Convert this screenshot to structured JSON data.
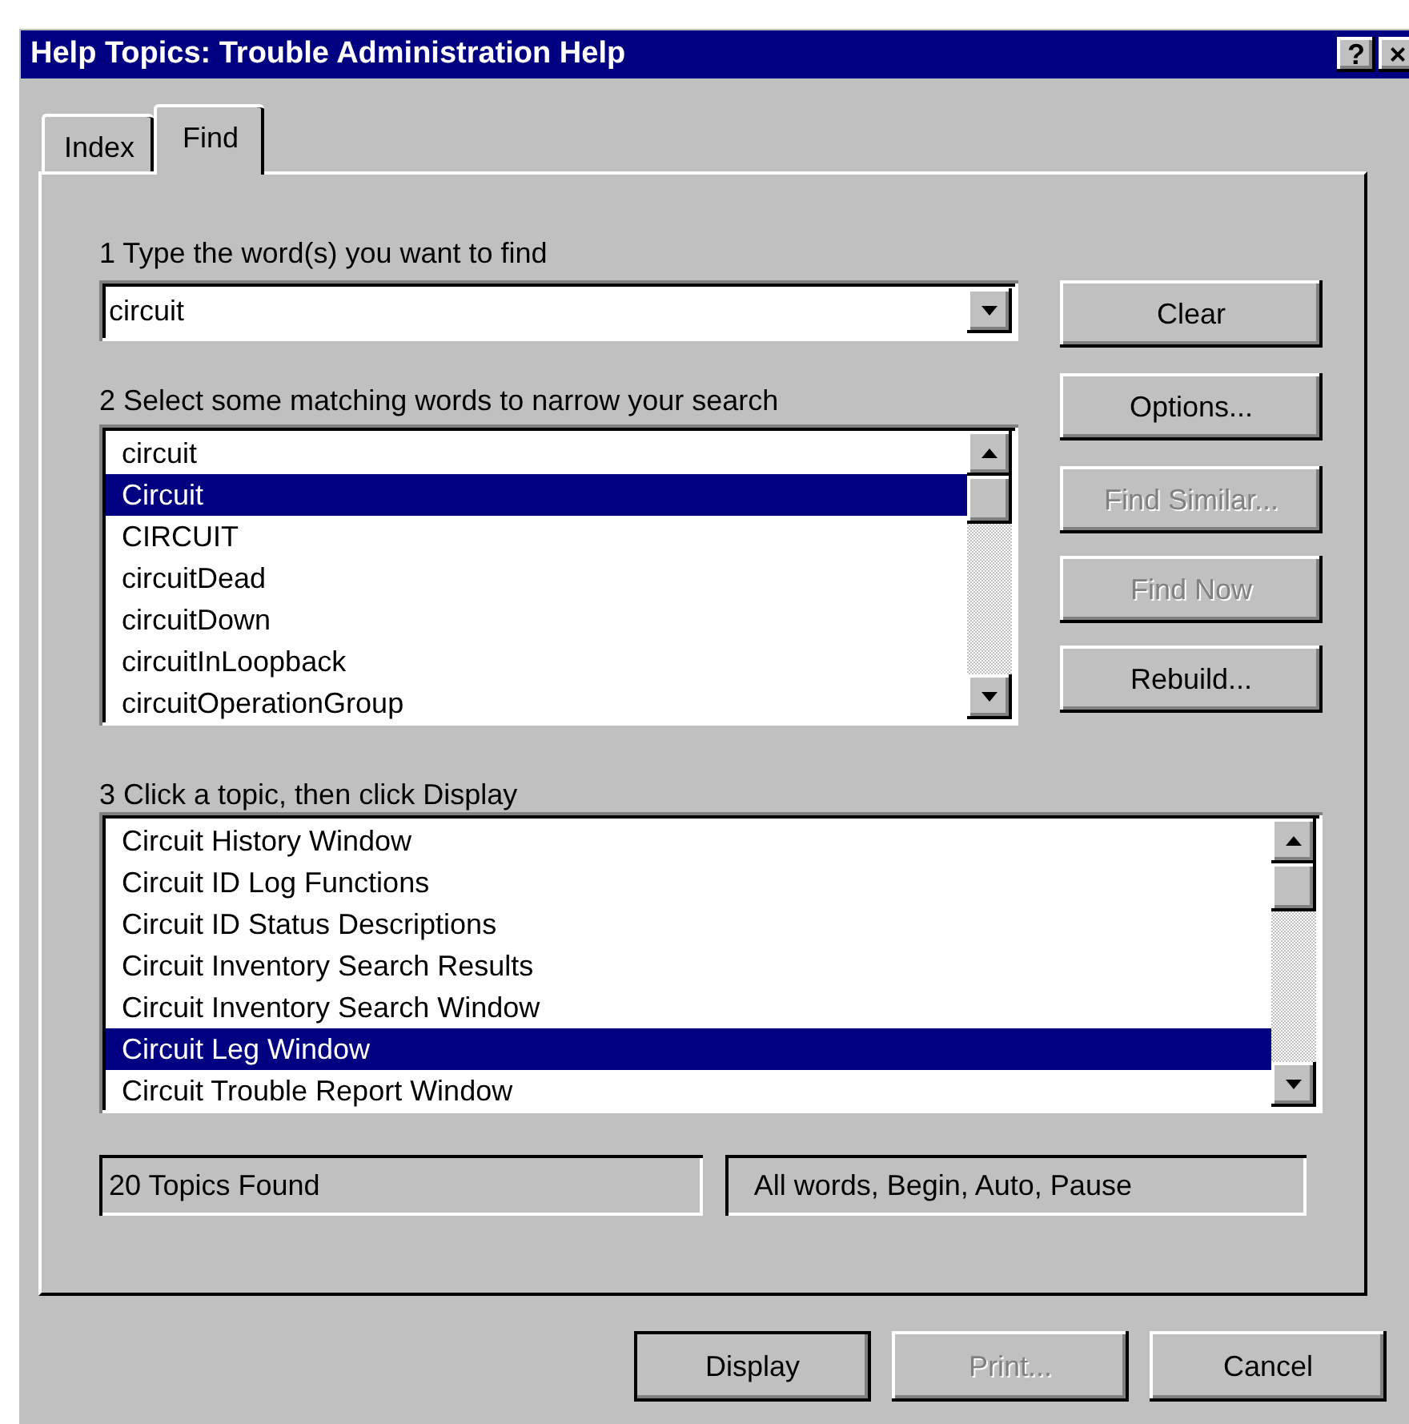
{
  "window": {
    "title": "Help Topics: Trouble Administration Help",
    "title_buttons": [
      {
        "label": "?"
      },
      {
        "label": "×"
      }
    ]
  },
  "tabs": [
    {
      "label": "Index",
      "selected": false
    },
    {
      "label": "Find",
      "selected": true
    }
  ],
  "step1": {
    "label": "1 Type the word(s) you want to find",
    "value": "circuit"
  },
  "step2": {
    "label": "2 Select some matching words to narrow your search",
    "items": [
      {
        "label": "circuit",
        "selected": false
      },
      {
        "label": "Circuit",
        "selected": true
      },
      {
        "label": "CIRCUIT",
        "selected": false
      },
      {
        "label": "circuitDead",
        "selected": false
      },
      {
        "label": "circuitDown",
        "selected": false
      },
      {
        "label": "circuitInLoopback",
        "selected": false
      },
      {
        "label": "circuitOperationGroup",
        "selected": false
      }
    ]
  },
  "side_buttons": [
    {
      "label": "Clear",
      "disabled": false
    },
    {
      "label": "Options...",
      "disabled": false
    },
    {
      "label": "Find Similar...",
      "disabled": true
    },
    {
      "label": "Find Now",
      "disabled": true
    },
    {
      "label": "Rebuild...",
      "disabled": false
    }
  ],
  "step3": {
    "label": "3 Click a topic, then click Display",
    "items": [
      {
        "label": "Circuit History Window",
        "selected": false
      },
      {
        "label": "Circuit ID Log Functions",
        "selected": false
      },
      {
        "label": "Circuit ID Status Descriptions",
        "selected": false
      },
      {
        "label": "Circuit Inventory Search Results",
        "selected": false
      },
      {
        "label": "Circuit Inventory Search Window",
        "selected": false
      },
      {
        "label": "Circuit Leg Window",
        "selected": true
      },
      {
        "label": "Circuit Trouble Report Window",
        "selected": false
      }
    ]
  },
  "status": [
    "20 Topics Found",
    "All words, Begin, Auto, Pause"
  ],
  "bottom_buttons": [
    {
      "label": "Display",
      "disabled": false,
      "default": true
    },
    {
      "label": "Print...",
      "disabled": true,
      "default": false
    },
    {
      "label": "Cancel",
      "disabled": false,
      "default": false
    }
  ]
}
